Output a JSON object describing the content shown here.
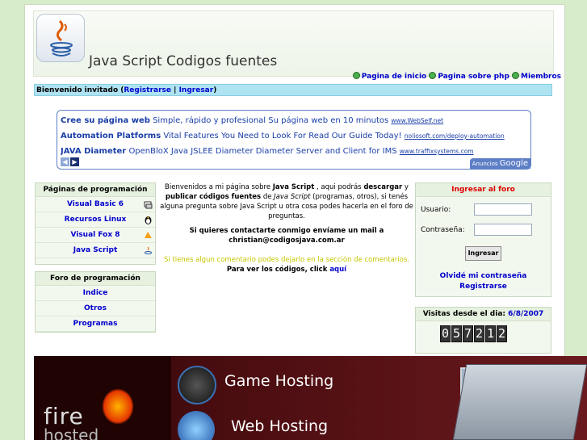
{
  "header": {
    "title": "Java Script Codigos fuentes"
  },
  "topnav": [
    {
      "label": "Pagina de inicio"
    },
    {
      "label": "Pagina sobre php"
    },
    {
      "label": "Miembros"
    }
  ],
  "welcome": {
    "prefix": "Bienvenido invitado (",
    "register": "Registrarse",
    "sep": " | ",
    "login": "Ingresar",
    "suffix": ")"
  },
  "ads": [
    {
      "title": "Cree su página web",
      "desc": "Simple, rápido y profesional Su página web en 10 minutos",
      "url": "www.WebSelf.net"
    },
    {
      "title": "Automation Platforms",
      "desc": "Vital Features You Need to Look For Read Our Guide Today!",
      "url": "noliosoft.com/deploy-automation"
    },
    {
      "title": "JAVA Diameter",
      "desc": "OpenBloX Java JSLEE Diameter Diameter Server and Client for IMS",
      "url": "www.traffixsystems.com"
    }
  ],
  "adsby": {
    "label": "Anuncios",
    "brand": "Google"
  },
  "left_menu": {
    "title": "Páginas de programación",
    "items": [
      {
        "label": "Visual Basic 6",
        "icon": "vb-icon"
      },
      {
        "label": "Recursos Linux",
        "icon": "linux-penguin-icon"
      },
      {
        "label": "Visual Fox 8",
        "icon": "fox-icon"
      },
      {
        "label": "Java Script",
        "icon": "java-icon"
      }
    ]
  },
  "forum_menu": {
    "title": "Foro de programación",
    "items": [
      {
        "label": "Indice"
      },
      {
        "label": "Otros"
      },
      {
        "label": "Programas"
      }
    ]
  },
  "center": {
    "p1a": "Bienvenidos a mi página sobre ",
    "p1b": "Java Script",
    "p1c": " , aqui podrás ",
    "p1d": "descargar",
    "p1e": " y ",
    "p1f": "publicar códigos fuentes",
    "p1g": " de ",
    "p1h": "Java Script",
    "p1i": " (programas, otros), si tenés alguna pregunta sobre Java Script u otra cosa podes hacerla en el foro de preguntas.",
    "contact": "Si quieres contactarte conmigo envíame un mail a christian@codigosjava.com.ar",
    "comment": "Si tienes algun comentario podes dejarlo en la sección de comentarios.",
    "codes": "Para ver los códigos, click ",
    "codes_link": "aquí"
  },
  "login": {
    "title": "Ingresar al foro",
    "user_label": "Usuario:",
    "pass_label": "Contraseña:",
    "button": "Ingresar",
    "forgot": "Olvidé mi contraseña",
    "register": "Registrarse"
  },
  "visits": {
    "label": "Visitas desde el dia: ",
    "date": "6/8/2007",
    "digits": [
      "0",
      "5",
      "7",
      "2",
      "1",
      "2"
    ]
  },
  "banner": {
    "game": "Game Hosting",
    "web": "Web Hosting",
    "brand1": "fire",
    "brand2": "hosted"
  },
  "colors": {
    "accent": "#0000cc",
    "welcome_bg": "#aee3f2",
    "login_title": "#dd0000",
    "page_bg": "#d7ecc9"
  }
}
